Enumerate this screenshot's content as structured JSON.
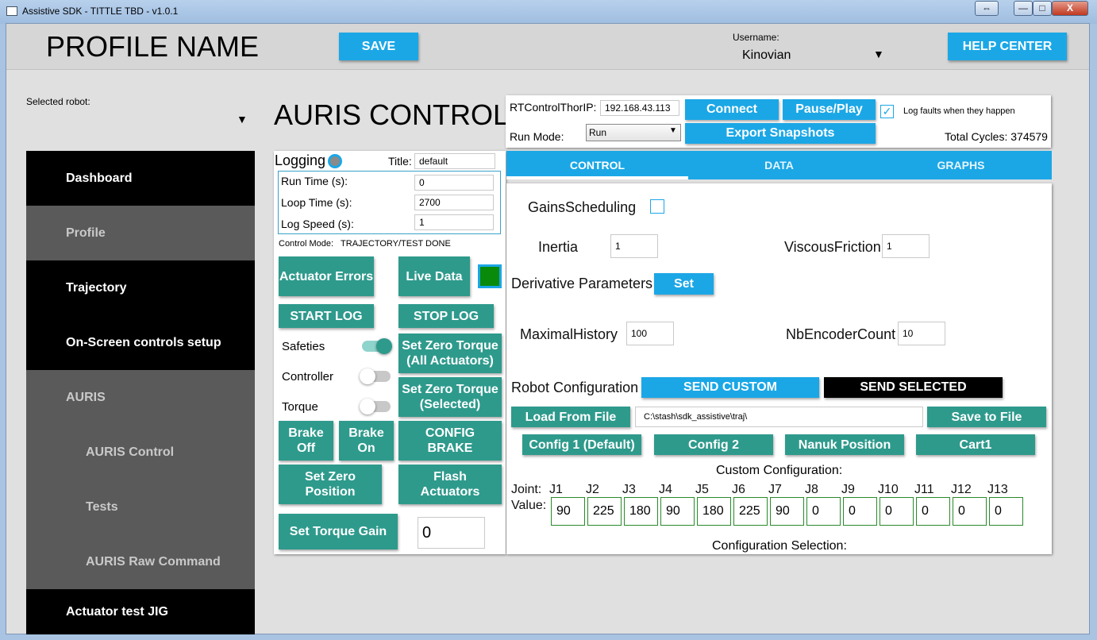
{
  "window": {
    "title": "Assistive SDK - TITTLE TBD - v1.0.1",
    "resize_glyph": "⇔",
    "min_glyph": "—",
    "max_glyph": "□",
    "close_glyph": "X"
  },
  "header": {
    "profile_name": "PROFILE NAME",
    "save_label": "SAVE",
    "username_label": "Username:",
    "username_value": "Kinovian",
    "help_label": "HELP CENTER"
  },
  "sidebar": {
    "selected_robot_label": "Selected robot:",
    "selected_robot_value": "",
    "items": [
      {
        "label": "Dashboard"
      },
      {
        "label": "Profile"
      },
      {
        "label": "Trajectory"
      },
      {
        "label": "On-Screen controls setup"
      },
      {
        "label": "AURIS"
      },
      {
        "label": "AURIS Control"
      },
      {
        "label": "Tests"
      },
      {
        "label": "AURIS Raw Command"
      },
      {
        "label": "Actuator test JIG"
      }
    ]
  },
  "page_title": "AURIS CONTROL",
  "logging": {
    "label": "Logging",
    "title_label": "Title:",
    "title_value": "default",
    "run_time_label": "Run Time (s):",
    "run_time_value": "0",
    "loop_time_label": "Loop Time (s):",
    "loop_time_value": "2700",
    "log_speed_label": "Log Speed (s):",
    "log_speed_value": "1",
    "control_mode": "Control Mode:   TRAJECTORY/TEST DONE"
  },
  "controls": {
    "actuator_errors": "Actuator Errors",
    "live_data": "Live Data",
    "start_log": "START LOG",
    "stop_log": "STOP LOG",
    "safeties": "Safeties",
    "controller": "Controller",
    "torque": "Torque",
    "set_zero_torque_all": "Set Zero Torque (All Actuators)",
    "set_zero_torque_selected": "Set Zero Torque (Selected)",
    "brake_off": "Brake Off",
    "brake_on": "Brake On",
    "config_brake": "CONFIG BRAKE",
    "set_zero_position": "Set Zero Position",
    "flash_actuators": "Flash Actuators",
    "set_torque_gain": "Set Torque Gain",
    "torque_gain_value": "0",
    "safeties_on": true,
    "controller_on": false,
    "torque_on": false
  },
  "connection": {
    "ip_label": "RTControlThorIP:",
    "ip_value": "192.168.43.113",
    "connect": "Connect",
    "pause_play": "Pause/Play",
    "log_faults_label": "Log faults when they happen",
    "log_faults_checked": true,
    "run_mode_label": "Run Mode:",
    "run_mode_value": "Run",
    "export_snapshots": "Export Snapshots",
    "total_cycles": "Total Cycles: 374579"
  },
  "tabs": [
    {
      "label": "CONTROL"
    },
    {
      "label": "DATA"
    },
    {
      "label": "GRAPHS"
    }
  ],
  "control_tab": {
    "gains_scheduling": "GainsScheduling",
    "inertia_label": "Inertia",
    "inertia_value": "1",
    "viscous_label": "ViscousFriction",
    "viscous_value": "1",
    "derivative_label": "Derivative Parameters",
    "set_label": "Set",
    "maximal_history_label": "MaximalHistory",
    "maximal_history_value": "100",
    "nb_encoder_label": "NbEncoderCount",
    "nb_encoder_value": "10",
    "robot_config_label": "Robot Configuration",
    "send_custom": "SEND CUSTOM",
    "send_selected": "SEND SELECTED",
    "load_from_file": "Load From File",
    "file_path": "C:\\stash\\sdk_assistive\\traj\\",
    "save_to_file": "Save to File",
    "presets": [
      "Config 1 (Default)",
      "Config 2",
      "Nanuk Position",
      "Cart1"
    ],
    "custom_config_label": "Custom Configuration:",
    "joint_label": "Joint:",
    "value_label": "Value:",
    "joints": [
      "J1",
      "J2",
      "J3",
      "J4",
      "J5",
      "J6",
      "J7",
      "J8",
      "J9",
      "J10",
      "J11",
      "J12",
      "J13"
    ],
    "values": [
      "90",
      "225",
      "180",
      "90",
      "180",
      "225",
      "90",
      "0",
      "0",
      "0",
      "0",
      "0",
      "0"
    ],
    "config_selection_label": "Configuration Selection:"
  },
  "colors": {
    "accent": "#1ba7e6",
    "teal": "#2e9a8c",
    "sidebar_dark": "#000000",
    "sidebar_grey": "#5a5a5a",
    "live_indicator": "#0a8a0a"
  }
}
